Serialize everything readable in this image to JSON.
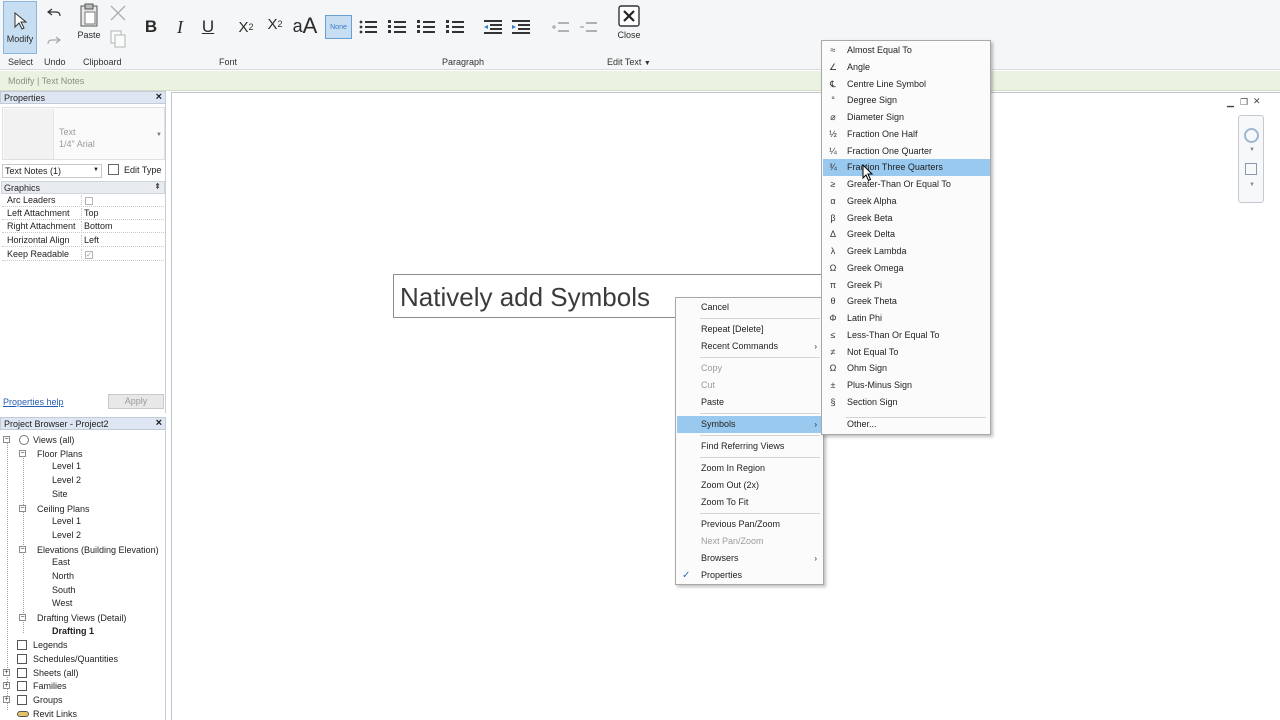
{
  "ribbon": {
    "modify": "Modify",
    "paste": "Paste",
    "close": "Close",
    "panels": [
      "Select",
      "Undo",
      "Clipboard",
      "Font",
      "Paragraph",
      "Edit Text"
    ],
    "none_btn": "None",
    "accent": "#99c9ef"
  },
  "context_bar": "Modify | Text Notes",
  "properties": {
    "title": "Properties",
    "type_name": "Text",
    "type_sub": "1/4\" Arial",
    "selector": "Text Notes (1)",
    "edit_type": "Edit Type",
    "group": "Graphics",
    "rows": [
      {
        "k": "Arc Leaders",
        "v": ""
      },
      {
        "k": "Left Attachment",
        "v": "Top"
      },
      {
        "k": "Right Attachment",
        "v": "Bottom"
      },
      {
        "k": "Horizontal Align",
        "v": "Left"
      },
      {
        "k": "Keep Readable",
        "v": ""
      }
    ],
    "help": "Properties help",
    "apply": "Apply"
  },
  "browser": {
    "title": "Project Browser - Project2",
    "items": [
      "Views (all)",
      "Floor Plans",
      "Level 1",
      "Level 2",
      "Site",
      "Ceiling Plans",
      "Level 1",
      "Level 2",
      "Elevations (Building Elevation)",
      "East",
      "North",
      "South",
      "West",
      "Drafting Views (Detail)",
      "Drafting 1",
      "Legends",
      "Schedules/Quantities",
      "Sheets (all)",
      "Families",
      "Groups",
      "Revit Links"
    ]
  },
  "canvas": {
    "text_note": "Natively add Symbols"
  },
  "context_menu": {
    "items": [
      "Cancel",
      "Repeat [Delete]",
      "Recent Commands",
      "Copy",
      "Cut",
      "Paste",
      "Symbols",
      "Find Referring Views",
      "Zoom In Region",
      "Zoom Out (2x)",
      "Zoom To Fit",
      "Previous Pan/Zoom",
      "Next Pan/Zoom",
      "Browsers",
      "Properties"
    ]
  },
  "symbols_menu": {
    "items": [
      {
        "sym": "≈",
        "label": "Almost Equal To"
      },
      {
        "sym": "∠",
        "label": "Angle"
      },
      {
        "sym": "℄",
        "label": "Centre Line Symbol"
      },
      {
        "sym": "°",
        "label": "Degree Sign"
      },
      {
        "sym": "⌀",
        "label": "Diameter Sign"
      },
      {
        "sym": "½",
        "label": "Fraction One Half"
      },
      {
        "sym": "¼",
        "label": "Fraction One Quarter"
      },
      {
        "sym": "¾",
        "label": "Fraction Three Quarters"
      },
      {
        "sym": "≥",
        "label": "Greater-Than Or Equal To"
      },
      {
        "sym": "α",
        "label": "Greek Alpha"
      },
      {
        "sym": "β",
        "label": "Greek Beta"
      },
      {
        "sym": "Δ",
        "label": "Greek Delta"
      },
      {
        "sym": "λ",
        "label": "Greek Lambda"
      },
      {
        "sym": "Ω",
        "label": "Greek Omega"
      },
      {
        "sym": "π",
        "label": "Greek Pi"
      },
      {
        "sym": "θ",
        "label": "Greek Theta"
      },
      {
        "sym": "Φ",
        "label": "Latin Phi"
      },
      {
        "sym": "≤",
        "label": "Less-Than Or Equal To"
      },
      {
        "sym": "≠",
        "label": "Not Equal To"
      },
      {
        "sym": "Ω",
        "label": "Ohm Sign"
      },
      {
        "sym": "±",
        "label": "Plus-Minus Sign"
      },
      {
        "sym": "§",
        "label": "Section Sign"
      }
    ],
    "other": "Other..."
  }
}
